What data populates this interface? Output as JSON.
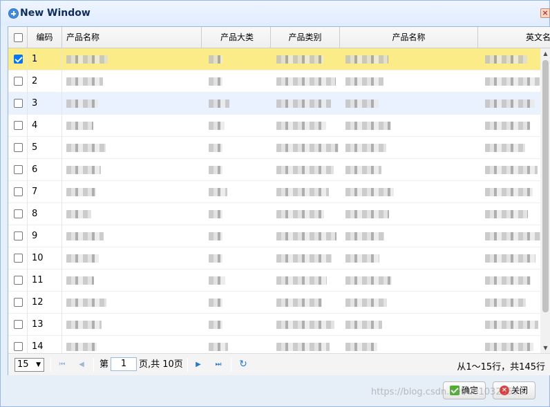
{
  "window": {
    "title": "New Window",
    "close_glyph": "×"
  },
  "grid": {
    "columns": [
      "编码",
      "产品名称",
      "产品大类",
      "产品类别",
      "产品名称",
      "英文名"
    ],
    "rows": [
      {
        "num": "1",
        "checked": true,
        "selected": true
      },
      {
        "num": "2",
        "checked": false
      },
      {
        "num": "3",
        "checked": false,
        "hover": true
      },
      {
        "num": "4",
        "checked": false
      },
      {
        "num": "5",
        "checked": false
      },
      {
        "num": "6",
        "checked": false
      },
      {
        "num": "7",
        "checked": false
      },
      {
        "num": "8",
        "checked": false
      },
      {
        "num": "9",
        "checked": false
      },
      {
        "num": "10",
        "checked": false
      },
      {
        "num": "11",
        "checked": false
      },
      {
        "num": "12",
        "checked": false
      },
      {
        "num": "13",
        "checked": false
      },
      {
        "num": "14",
        "checked": false
      }
    ]
  },
  "pager": {
    "page_size": "15",
    "page_label_before": "第",
    "current_page": "1",
    "page_label_after": "页,共 10页",
    "info": "从1～15行，共145行"
  },
  "buttons": {
    "ok": "确定",
    "cancel": "关闭"
  },
  "watermark": "https://blog.csdn.net/u010325599",
  "colors": {
    "selected_row": "#FBEC88",
    "hover_row": "#EAF2FF",
    "border": "#95B8E7"
  }
}
